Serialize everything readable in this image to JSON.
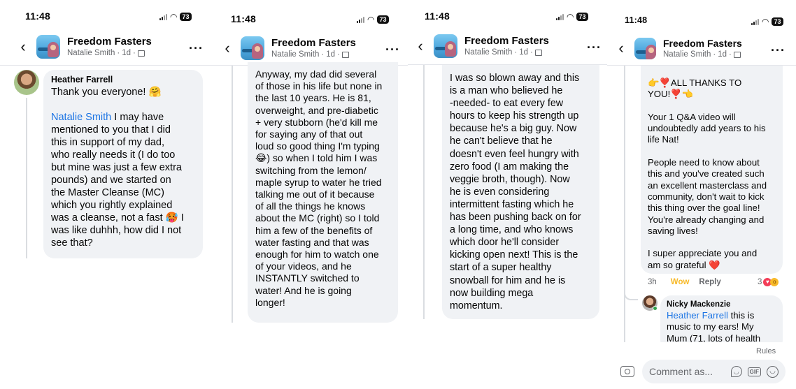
{
  "panels": [
    {
      "status": {
        "time": "11:48",
        "battery": "73"
      },
      "header": {
        "group_name": "Freedom Fasters",
        "author": "Natalie Smith",
        "age": "1d"
      },
      "comment": {
        "author": "Heather Farrell",
        "line1": "Thank you everyone! 🤗",
        "mention": "Natalie Smith",
        "text": " I may have\nmentioned to you that I did\nthis in support of my dad,\nwho really needs it (I do too\nbut mine was just a few extra\npounds) and we started on\nthe Master Cleanse (MC)\nwhich you rightly explained\nwas a cleanse, not a fast 🥵 I\nwas like duhhh, how did I not\nsee that?"
      }
    },
    {
      "status": {
        "time": "11:48",
        "battery": "73"
      },
      "header": {
        "group_name": "Freedom Fasters",
        "author": "Natalie Smith",
        "age": "1d"
      },
      "text": "Anyway, my dad did several\nof those in his life but none in\nthe last 10 years. He is 81,\noverweight, and pre-diabetic\n+ very stubborn (he'd kill me\nfor saying any of that out\nloud so good thing I'm typing\n😂) so when I told him I was\nswitching from the lemon/\nmaple syrup to water he tried\ntalking me out of it because\nof all the things he knows\nabout the MC (right) so I told\nhim a few of the benefits of\nwater fasting and that was\nenough for him to watch one\nof your videos, and he\nINSTANTLY switched to\nwater! And he is going\nlonger!"
    },
    {
      "status": {
        "time": "11:48",
        "battery": "73"
      },
      "header": {
        "group_name": "Freedom Fasters",
        "author": "Natalie Smith",
        "age": "1d"
      },
      "text": "I was so blown away and this\nis a man who believed he\n-needed- to eat every few\nhours to keep his strength up\nbecause he's a big guy. Now\nhe can't believe that he\ndoesn't even feel hungry with\nzero food (I am making the\nveggie broth, though). Now\nhe is even considering\nintermittent fasting which he\nhas been pushing back on for\na long time, and who knows\nwhich door he'll consider\nkicking open next! This is the\nstart of a super healthy\nsnowball for him and he is\nnow building mega\nmomentum."
    },
    {
      "status": {
        "time": "11:48",
        "battery": "73"
      },
      "header": {
        "group_name": "Freedom Fasters",
        "author": "Natalie Smith",
        "age": "1d"
      },
      "text": "👉❣️ALL THANKS TO\nYOU!❣️👈\n\nYour 1 Q&A video will\nundoubtedly add years to his\nlife Nat!\n\nPeople need to know about\nthis and you've created such\nan excellent masterclass and\ncommunity, don't wait to kick\nthis thing over the goal line!\nYou're already changing and\nsaving lives!\n\nI super appreciate you and\nam so grateful ❤️",
      "meta": {
        "time": "3h",
        "reaction": "Wow",
        "reply": "Reply",
        "reaction_count": "3"
      },
      "reply": {
        "author": "Nicky Mackenzie",
        "mention": "Heather Farrell",
        "text": " this is\nmusic to my ears! My\nMum (71, lots of health"
      },
      "footer": {
        "rules": "Rules",
        "comment_placeholder": "Comment as...",
        "gif": "GIF"
      }
    }
  ]
}
